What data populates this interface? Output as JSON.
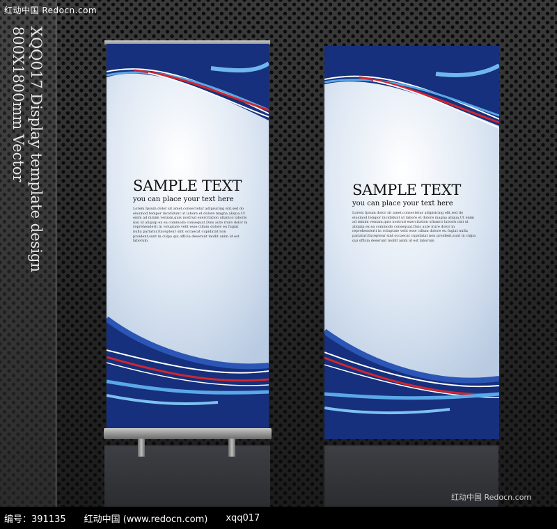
{
  "watermark_top": "红动中国 Redocn.com",
  "side_title": "XQQ017 Display template design",
  "side_size": "800X1800mm Vector",
  "banners": [
    {
      "title": "SAMPLE TEXT",
      "subtitle": "you can place your text here",
      "body": "Lorem Ipsum dolor sit amet,consectetur adipisicing elit,sed do eiusmod tempor incididunt ut labore et dolore magna aliqua.Ut enim ad minim veniam,quis nostrud exercitation ullamco laboris nisi ut aliquip ex ea commodo consequat.Duis aute irure dolor in reprehenderit in voluptate velit esse cillum dolore eu fugiat nulla pariatur.Excepteur sint occaecat cupidatat non proident,sunt in culpa qui officia deserunt mollit anim id est laborum"
    },
    {
      "title": "SAMPLE TEXT",
      "subtitle": "you can place your text here",
      "body": "Lorem Ipsum dolor sit amet,consectetur adipisicing elit,sed do eiusmod tempor incididunt ut labore et dolore magna aliqua.Ut enim ad minim veniam,quis nostrud exercitation ullamco laboris nisi ut aliquip ex ea commodo consequat.Duis aute irure dolor in reprehenderit in voluptate velit esse cillum dolore eu fugiat nulla pariatur.Excepteur sint occaecat cupidatat non proident,sunt in culpa qui officia deserunt mollit anim id est laborum"
    }
  ],
  "footer": {
    "id_text": "编号：391135",
    "site_text": "红动中国 (www.redocn.com)",
    "code_text": "xqq017"
  },
  "watermark_bottom": "红动中国 Redocn.com",
  "colors": {
    "banner_blue": "#16307d",
    "accent_light_blue": "#5aa8e8",
    "accent_red": "#d0262f",
    "accent_white": "#ffffff"
  }
}
